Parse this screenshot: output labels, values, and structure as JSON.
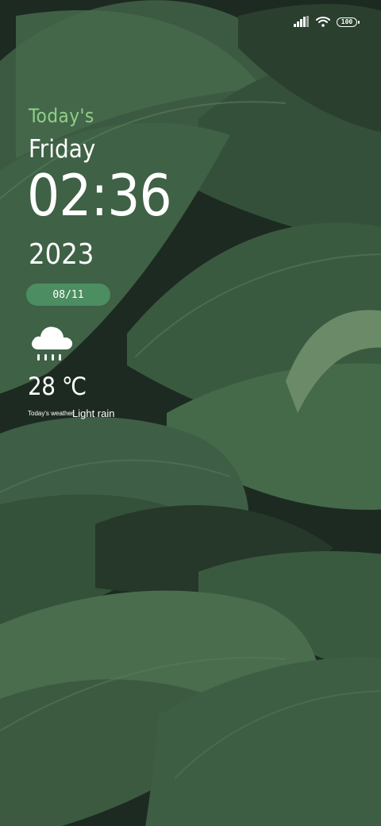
{
  "status_bar": {
    "signal_icon": "signal-bars-icon",
    "wifi_icon": "wifi-icon",
    "battery_level": "100"
  },
  "lockscreen": {
    "greeting": "Today's",
    "weekday": "Friday",
    "time": "02:36",
    "year": "2023",
    "date": "08/11"
  },
  "weather": {
    "icon": "rain-cloud-icon",
    "temperature": "28 ℃",
    "caption": "Today's weather",
    "condition": "Light rain"
  },
  "colors": {
    "accent_green": "#8fd08a",
    "pill_green": "#4c8d61",
    "leaf_dark": "#2f4a35",
    "text": "#ffffff"
  },
  "wallpaper": "tropical-leaves"
}
